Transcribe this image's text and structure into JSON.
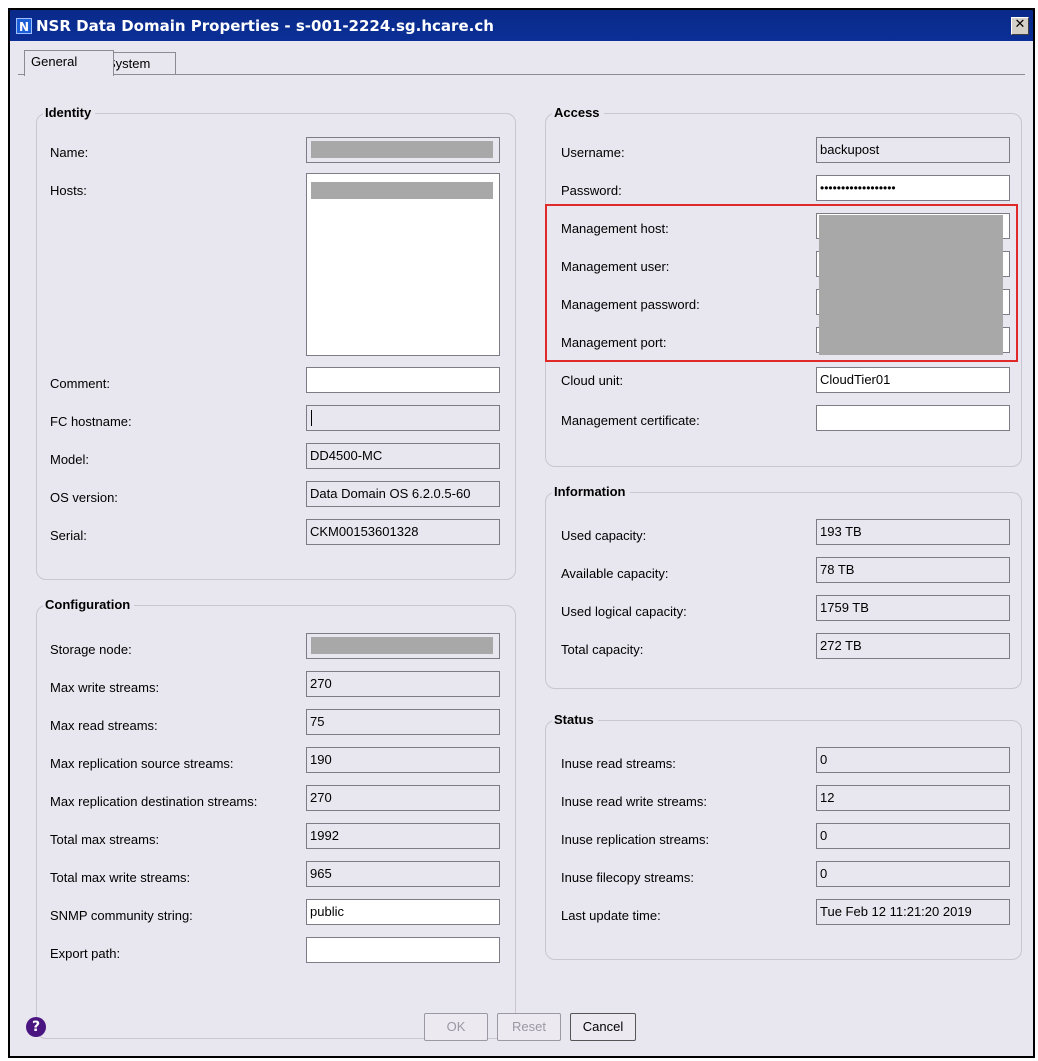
{
  "window": {
    "title": "NSR Data Domain Properties - s-001-2224.sg.hcare.ch",
    "app_icon_letter": "N",
    "close_label": "✕"
  },
  "tabs": [
    {
      "label": "General",
      "active": true
    },
    {
      "label": "System",
      "active": false
    }
  ],
  "identity": {
    "title": "Identity",
    "name_label": "Name:",
    "hosts_label": "Hosts:",
    "comment_label": "Comment:",
    "comment_value": "",
    "fc_hostname_label": "FC hostname:",
    "fc_hostname_value": "",
    "model_label": "Model:",
    "model_value": "DD4500-MC",
    "os_version_label": "OS version:",
    "os_version_value": "Data Domain OS 6.2.0.5-60",
    "serial_label": "Serial:",
    "serial_value": "CKM00153601328"
  },
  "configuration": {
    "title": "Configuration",
    "storage_node_label": "Storage node:",
    "max_write_streams_label": "Max write streams:",
    "max_write_streams_value": "270",
    "max_read_streams_label": "Max read streams:",
    "max_read_streams_value": "75",
    "max_repl_source_label": "Max replication source streams:",
    "max_repl_source_value": "190",
    "max_repl_dest_label": "Max replication destination streams:",
    "max_repl_dest_value": "270",
    "total_max_streams_label": "Total max streams:",
    "total_max_streams_value": "1992",
    "total_max_write_streams_label": "Total max write streams:",
    "total_max_write_streams_value": "965",
    "snmp_label": "SNMP community string:",
    "snmp_value": "public",
    "export_path_label": "Export path:",
    "export_path_value": ""
  },
  "access": {
    "title": "Access",
    "username_label": "Username:",
    "username_value": "backupost",
    "password_label": "Password:",
    "password_value": "••••••••••••••••••",
    "mgmt_host_label": "Management host:",
    "mgmt_user_label": "Management user:",
    "mgmt_password_label": "Management password:",
    "mgmt_port_label": "Management port:",
    "cloud_unit_label": "Cloud unit:",
    "cloud_unit_value": "CloudTier01",
    "mgmt_cert_label": "Management certificate:",
    "mgmt_cert_value": ""
  },
  "information": {
    "title": "Information",
    "used_capacity_label": "Used capacity:",
    "used_capacity_value": "193 TB",
    "available_capacity_label": "Available capacity:",
    "available_capacity_value": "78 TB",
    "used_logical_label": "Used logical capacity:",
    "used_logical_value": "1759 TB",
    "total_capacity_label": "Total capacity:",
    "total_capacity_value": "272 TB"
  },
  "status": {
    "title": "Status",
    "inuse_read_label": "Inuse read streams:",
    "inuse_read_value": "0",
    "inuse_read_write_label": "Inuse read write streams:",
    "inuse_read_write_value": "12",
    "inuse_replication_label": "Inuse replication streams:",
    "inuse_replication_value": "0",
    "inuse_filecopy_label": "Inuse filecopy streams:",
    "inuse_filecopy_value": "0",
    "last_update_label": "Last update time:",
    "last_update_value": "Tue Feb 12 11:21:20 2019"
  },
  "buttons": {
    "ok": "OK",
    "reset": "Reset",
    "cancel": "Cancel",
    "help": "?"
  },
  "colors": {
    "titlebar": "#0b2f97",
    "dialog_bg": "#e8e6ee",
    "highlight": "#e02a2a",
    "help_icon": "#4a1580"
  }
}
